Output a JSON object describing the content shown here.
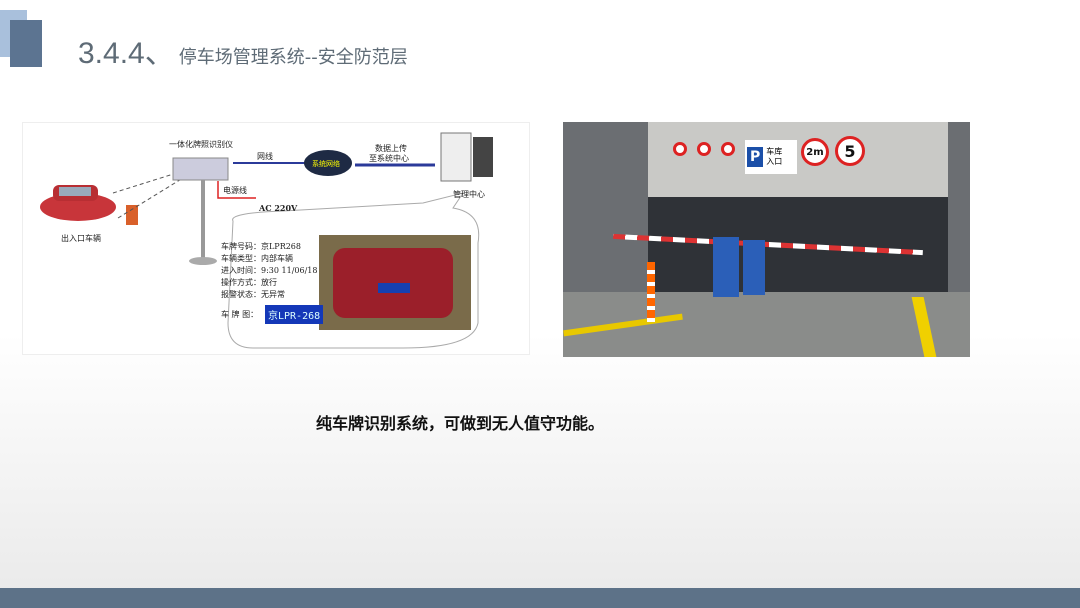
{
  "slide": {
    "section_number": "3.4.4、",
    "title": "停车场管理系统--安全防范层",
    "caption": "纯车牌识别系统，可做到无人值守功能。"
  },
  "diagram": {
    "camera_label": "一体化牌照识别仪",
    "network_cable": "网线",
    "network_cloud": "系统网络",
    "upload_label_1": "数据上传",
    "upload_label_2": "至系统中心",
    "management_center": "管理中心",
    "power_cable": "电源线",
    "power_spec": "AC 220V",
    "vehicle_label": "出入口车辆",
    "info": [
      {
        "k": "车牌号码：",
        "v": "京LPR268"
      },
      {
        "k": "车辆类型：",
        "v": "内部车辆"
      },
      {
        "k": "进入时间：",
        "v": "9:30 11/06/18"
      },
      {
        "k": "操作方式：",
        "v": "放行"
      },
      {
        "k": "报警状态：",
        "v": "无异常"
      }
    ],
    "plate_image_label": "车 牌 图：",
    "plate_text": "京LPR-268"
  },
  "photo": {
    "entrance_sign": "车库入口",
    "height_limit": "2m",
    "speed_limit": "5",
    "parking_sign": "P"
  },
  "colors": {
    "footer": "#5d7288",
    "accent_light": "#a9c0dc",
    "title": "#5e6b76"
  }
}
